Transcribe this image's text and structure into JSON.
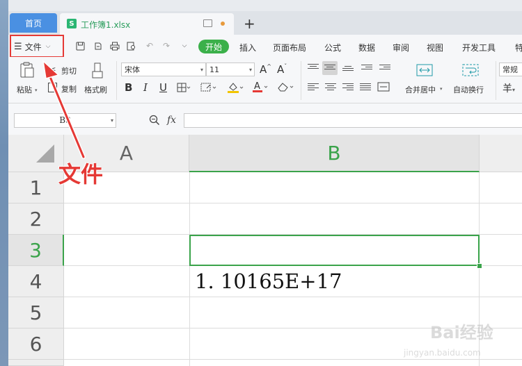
{
  "tabs": {
    "home": "首页",
    "document": "工作簿1.xlsx",
    "doc_icon": "S",
    "new_tab": "+"
  },
  "menu": {
    "file_label": "文件",
    "ribbon_tabs": [
      "开始",
      "插入",
      "页面布局",
      "公式",
      "数据",
      "审阅",
      "视图",
      "开发工具",
      "特"
    ]
  },
  "ribbon": {
    "paste": "粘贴",
    "cut": "剪切",
    "copy": "复制",
    "format_painter": "格式刷",
    "font_name": "宋体",
    "font_size": "11",
    "grow_font": "A",
    "shrink_font": "A",
    "bold": "B",
    "italic": "I",
    "underline": "U",
    "merge_center": "合并居中",
    "wrap_text": "自动换行",
    "number_format": "常规",
    "currency": "羊"
  },
  "formula_bar": {
    "name_box": "B3",
    "fx": "fx",
    "formula": ""
  },
  "grid": {
    "columns": [
      "A",
      "B"
    ],
    "rows": [
      "1",
      "2",
      "3",
      "4",
      "5",
      "6"
    ],
    "selected_cell": "B3",
    "cell_b4": "1. 10165E+17"
  },
  "annotation": {
    "text": "文件",
    "color": "#e53935"
  },
  "watermark": {
    "brand": "Bai经验",
    "url": "jingyan.baidu.com"
  },
  "colors": {
    "accent_green": "#3bb04a",
    "home_tab": "#4a90e2",
    "highlight_red": "#e53935"
  }
}
